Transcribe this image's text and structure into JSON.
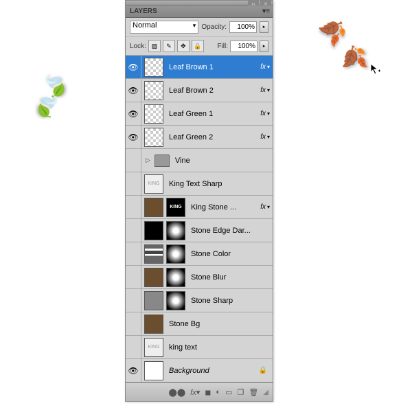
{
  "panel": {
    "title": "LAYERS"
  },
  "options": {
    "blend_mode": "Normal",
    "opacity_label": "Opacity:",
    "opacity_value": "100%",
    "lock_label": "Lock:",
    "fill_label": "Fill:",
    "fill_value": "100%"
  },
  "layers": [
    {
      "visible": true,
      "name": "Leaf Brown 1",
      "fx": true,
      "selected": true,
      "thumbs": [
        "checker"
      ]
    },
    {
      "visible": true,
      "name": "Leaf Brown 2",
      "fx": true,
      "thumbs": [
        "checker"
      ]
    },
    {
      "visible": true,
      "name": "Leaf Green 1",
      "fx": true,
      "thumbs": [
        "checker"
      ]
    },
    {
      "visible": true,
      "name": "Leaf Green 2",
      "fx": true,
      "thumbs": [
        "checker"
      ]
    },
    {
      "visible": false,
      "name": "Vine",
      "folder": true
    },
    {
      "visible": false,
      "name": "King Text Sharp",
      "thumbs": [
        "kingtext-light"
      ]
    },
    {
      "visible": false,
      "name": "King Stone ...",
      "fx": true,
      "thumbs": [
        "brown",
        "kingtext"
      ]
    },
    {
      "visible": false,
      "name": "Stone Edge Dar...",
      "thumbs": [
        "black",
        "maskblur"
      ]
    },
    {
      "visible": false,
      "name": "Stone Color",
      "thumbs": [
        "grads",
        "maskblur"
      ]
    },
    {
      "visible": false,
      "name": "Stone Blur",
      "thumbs": [
        "brown",
        "maskblur"
      ]
    },
    {
      "visible": false,
      "name": "Stone Sharp",
      "thumbs": [
        "gray",
        "maskblur"
      ]
    },
    {
      "visible": false,
      "name": "Stone Bg",
      "thumbs": [
        "brown"
      ]
    },
    {
      "visible": false,
      "name": "king text",
      "thumbs": [
        "kingtext-light"
      ]
    },
    {
      "visible": true,
      "name": "Background",
      "locked": true,
      "bg": true,
      "thumbs": [
        "white"
      ]
    }
  ]
}
